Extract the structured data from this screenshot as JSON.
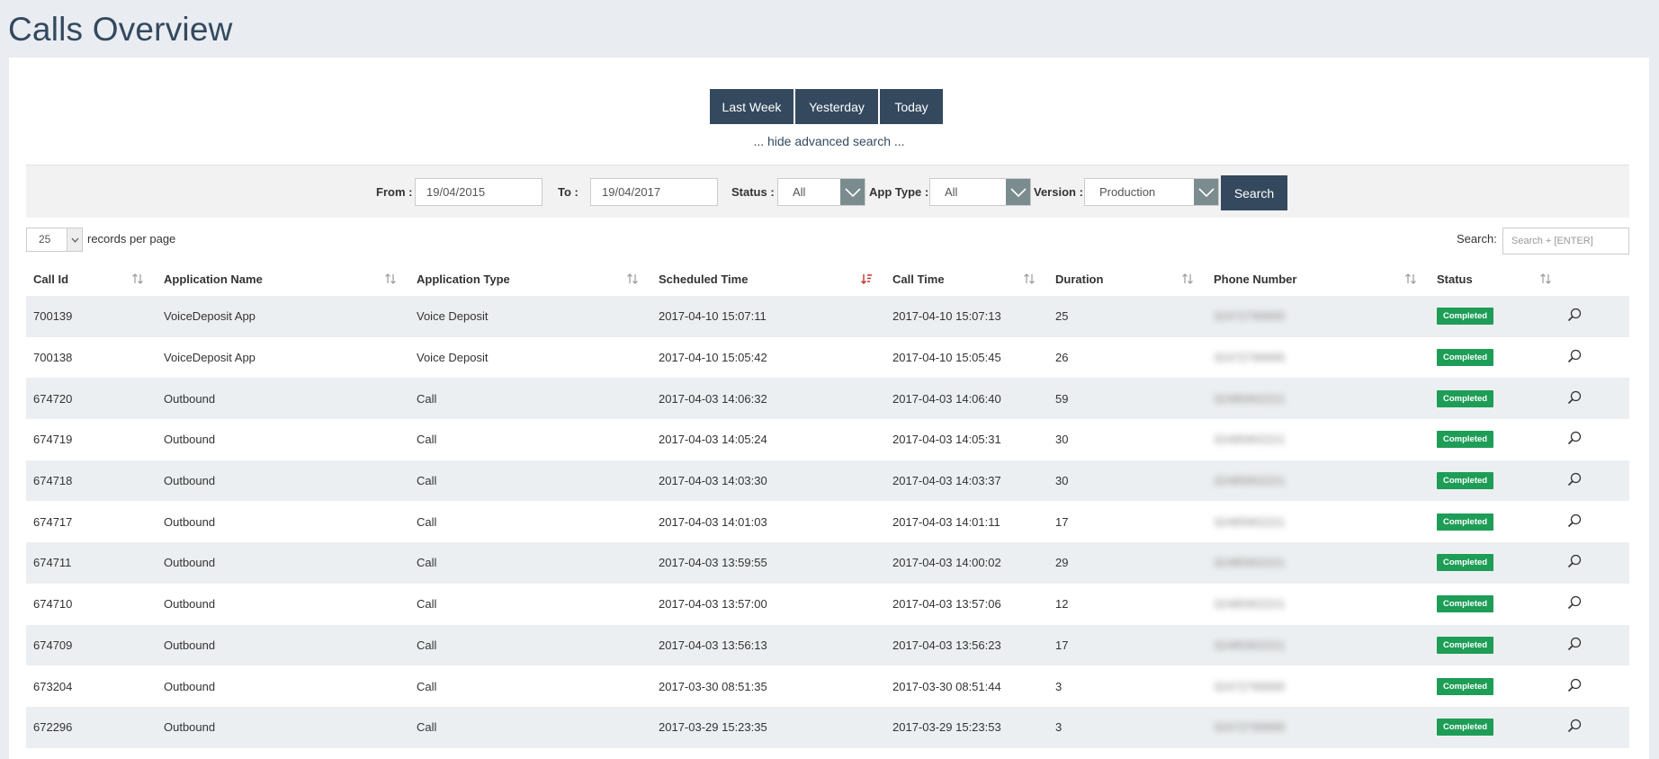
{
  "page": {
    "title": "Calls Overview"
  },
  "quick_range": {
    "last_week": "Last Week",
    "yesterday": "Yesterday",
    "today": "Today"
  },
  "advanced_toggle": "... hide advanced search ...",
  "filters": {
    "from_label": "From :",
    "from_value": "19/04/2015",
    "to_label": "To :",
    "to_value": "19/04/2017",
    "status_label": "Status :",
    "status_value": "All",
    "app_type_label": "App Type :",
    "app_type_value": "All",
    "version_label": "Version :",
    "version_value": "Production",
    "search_button": "Search"
  },
  "table_controls": {
    "records_per_page_value": "25",
    "records_per_page_label": "records per page",
    "search_label": "Search:",
    "search_placeholder": "Search + [ENTER]"
  },
  "columns": [
    "Call Id",
    "Application Name",
    "Application Type",
    "Scheduled Time",
    "Call Time",
    "Duration",
    "Phone Number",
    "Status"
  ],
  "sorted_column": "Scheduled Time",
  "colors": {
    "header_bg": "#34495e",
    "sorted_icon": "#c0392b",
    "status_completed": "#1e9d57",
    "row_stripe": "#eceff1"
  },
  "rows": [
    {
      "call_id": "700139",
      "app_name": "VoiceDeposit App",
      "app_type": "Voice Deposit",
      "scheduled": "2017-04-10 15:07:11",
      "call_time": "2017-04-10 15:07:13",
      "duration": "25",
      "phone": "32472799995",
      "status": "Completed"
    },
    {
      "call_id": "700138",
      "app_name": "VoiceDeposit App",
      "app_type": "Voice Deposit",
      "scheduled": "2017-04-10 15:05:42",
      "call_time": "2017-04-10 15:05:45",
      "duration": "26",
      "phone": "32472799995",
      "status": "Completed"
    },
    {
      "call_id": "674720",
      "app_name": "Outbound",
      "app_type": "Call",
      "scheduled": "2017-04-03 14:06:32",
      "call_time": "2017-04-03 14:06:40",
      "duration": "59",
      "phone": "32485902221",
      "status": "Completed"
    },
    {
      "call_id": "674719",
      "app_name": "Outbound",
      "app_type": "Call",
      "scheduled": "2017-04-03 14:05:24",
      "call_time": "2017-04-03 14:05:31",
      "duration": "30",
      "phone": "32485902221",
      "status": "Completed"
    },
    {
      "call_id": "674718",
      "app_name": "Outbound",
      "app_type": "Call",
      "scheduled": "2017-04-03 14:03:30",
      "call_time": "2017-04-03 14:03:37",
      "duration": "30",
      "phone": "32485902221",
      "status": "Completed"
    },
    {
      "call_id": "674717",
      "app_name": "Outbound",
      "app_type": "Call",
      "scheduled": "2017-04-03 14:01:03",
      "call_time": "2017-04-03 14:01:11",
      "duration": "17",
      "phone": "32485902221",
      "status": "Completed"
    },
    {
      "call_id": "674711",
      "app_name": "Outbound",
      "app_type": "Call",
      "scheduled": "2017-04-03 13:59:55",
      "call_time": "2017-04-03 14:00:02",
      "duration": "29",
      "phone": "32485902221",
      "status": "Completed"
    },
    {
      "call_id": "674710",
      "app_name": "Outbound",
      "app_type": "Call",
      "scheduled": "2017-04-03 13:57:00",
      "call_time": "2017-04-03 13:57:06",
      "duration": "12",
      "phone": "32485902221",
      "status": "Completed"
    },
    {
      "call_id": "674709",
      "app_name": "Outbound",
      "app_type": "Call",
      "scheduled": "2017-04-03 13:56:13",
      "call_time": "2017-04-03 13:56:23",
      "duration": "17",
      "phone": "32485902221",
      "status": "Completed"
    },
    {
      "call_id": "673204",
      "app_name": "Outbound",
      "app_type": "Call",
      "scheduled": "2017-03-30 08:51:35",
      "call_time": "2017-03-30 08:51:44",
      "duration": "3",
      "phone": "32472799995",
      "status": "Completed"
    },
    {
      "call_id": "672296",
      "app_name": "Outbound",
      "app_type": "Call",
      "scheduled": "2017-03-29 15:23:35",
      "call_time": "2017-03-29 15:23:53",
      "duration": "3",
      "phone": "32472799995",
      "status": "Completed"
    }
  ]
}
